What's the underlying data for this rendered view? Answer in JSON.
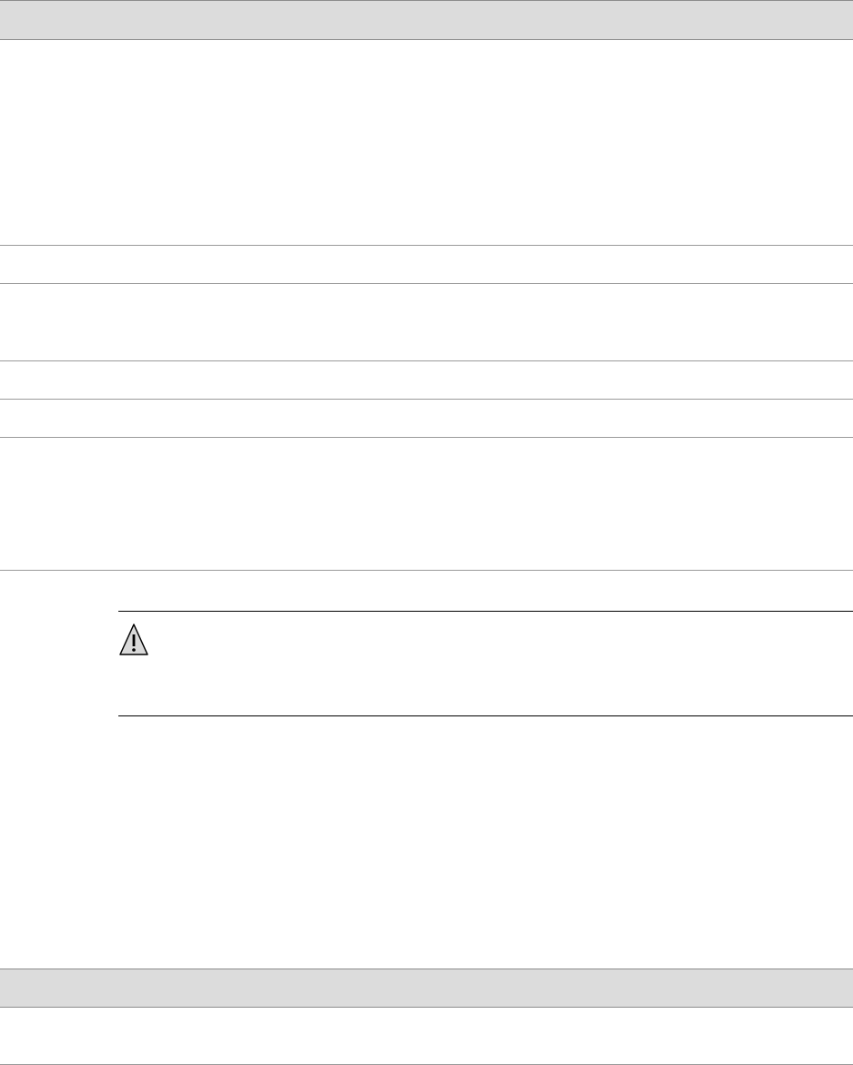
{
  "colors": {
    "header_band": "#dcdcdc",
    "row_rule": "#9a9a9a",
    "caution_rule": "#000000"
  },
  "icons": {
    "caution": "warning-triangle-icon"
  }
}
